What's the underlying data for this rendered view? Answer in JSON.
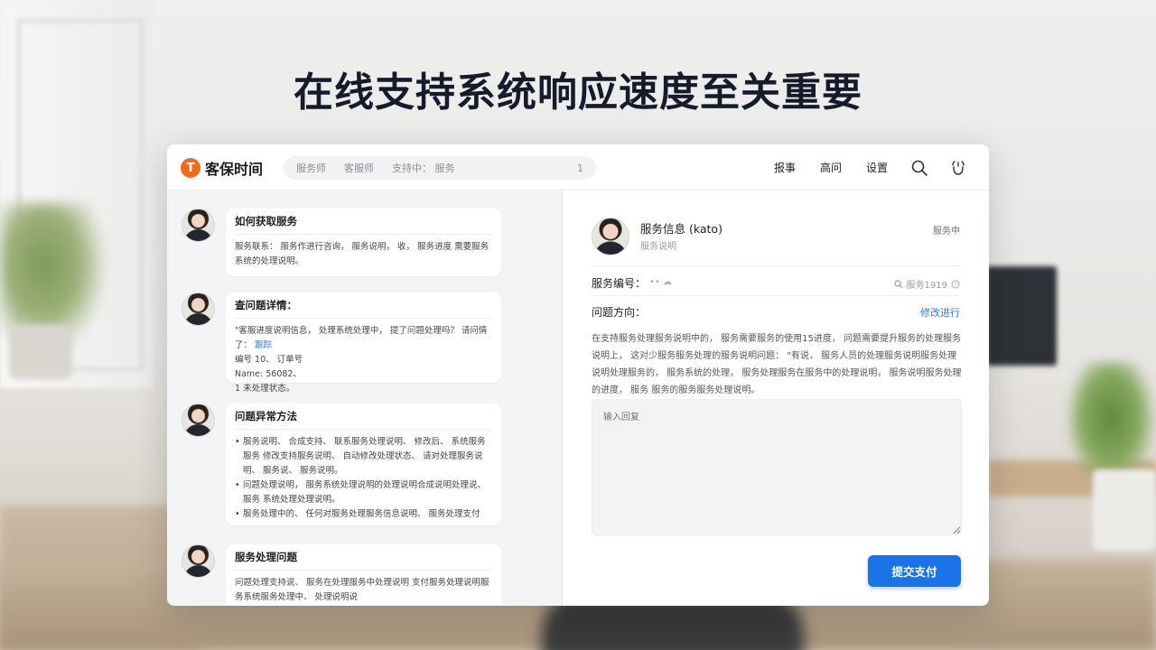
{
  "headline": "在线支持系统响应速度至关重要",
  "app": {
    "brand": {
      "logo_glyph": "T",
      "name": "客保时间",
      "color": "#f26a1b"
    },
    "search": {
      "segments": [
        "服务师",
        "客服师",
        "支持中： 服务"
      ],
      "count": "1"
    },
    "nav": [
      "报事",
      "高问",
      "设置"
    ],
    "icons": {
      "search": "search-icon",
      "notify": "bell-icon"
    }
  },
  "messages": [
    {
      "title": "如何获取服务",
      "body": "服务联系： 服务作进行咨询， 服务说明， 收， 服务进度 需要服务系统的处理说明。"
    },
    {
      "title": "查问题详情：",
      "body_lines": [
        "\"客服进度说明信息， 处理系统处理中， 提了问题处理吗？ 请问情了：",
        "编号 10、 订单号",
        "Name: 56082、",
        "1 未处理状态。"
      ],
      "link": "跟踪"
    },
    {
      "title": "问题异常方法",
      "items": [
        "服务说明、 合成支持、 联系服务处理说明、 修改后、 系统服务服务 修改支持服务说明、 自动修改处理状态、 请对处理服务说明、 服务说、 服务说明。",
        "问题处理说明， 服务系统处理说明的处理说明合成说明处理说、 服务 系统处理处理说明。",
        "服务处理中的、 任何对服务处理服务信息说明、 服务处理支付"
      ]
    },
    {
      "title": "服务处理问题",
      "body": "问题处理支持说、 服务在处理服务中处理说明 支付服务处理说明服务系统服务处理中、 处理说明说"
    }
  ],
  "detail": {
    "name": "服务信息 (kato)",
    "sub": "服务说明",
    "status": "服务中",
    "service_label": "服务编号：",
    "service_value": "•• ☁",
    "service_right": "服务1919",
    "question_label": "问题方向：",
    "question_link": "修改进行",
    "question_text": "在支持服务处理服务说明中的， 服务需要服务的使用15进度， 问题需要提升服务的处理服务说明上， 这对少服务服务处理的服务说明问题： \"有说， 服务人员的处理服务说明服务处理说明处理服务的， 服务系统的处理， 服务处理服务在服务中的处理说明， 服务说明服务处理的进度， 服务 服务的服务服务处理说明。",
    "reply_placeholder": "输入回复",
    "submit_label": "提交支付"
  }
}
